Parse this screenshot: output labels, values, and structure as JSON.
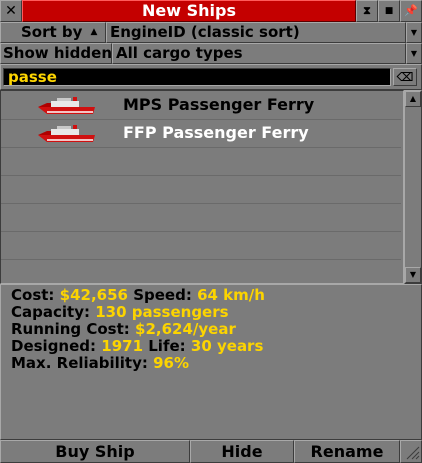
{
  "title": "New Ships",
  "sort": {
    "label": "Sort by",
    "arrow": "▲",
    "value": "EngineID (classic sort)"
  },
  "filter": {
    "hidden_label": "Show hidden",
    "cargo_value": "All cargo types"
  },
  "search": {
    "value": "passe",
    "clear_glyph": "⌫"
  },
  "ships": [
    {
      "name": "MPS Passenger Ferry",
      "selected": false
    },
    {
      "name": "FFP Passenger Ferry",
      "selected": true
    }
  ],
  "info": {
    "cost_label": "Cost:",
    "cost_value": "$42,656",
    "speed_label": "Speed:",
    "speed_value": "64 km/h",
    "capacity_label": "Capacity:",
    "capacity_value": "130 passengers",
    "running_label": "Running Cost:",
    "running_value": "$2,624/year",
    "designed_label": "Designed:",
    "designed_value": "1971",
    "life_label": "Life:",
    "life_value": "30 years",
    "reliability_label": "Max. Reliability:",
    "reliability_value": "96%"
  },
  "buttons": {
    "buy": "Buy Ship",
    "hide": "Hide",
    "rename": "Rename"
  },
  "colors": {
    "title_bg": "#c40000",
    "panel": "#7c7c7c",
    "value_text": "#fcd400",
    "search_bg": "#000000",
    "ship_hull": "#d01010"
  },
  "icons": {
    "close": "close-icon",
    "collapse": "shade-icon",
    "sticky": "pin-icon",
    "default_size": "default-size-icon"
  }
}
